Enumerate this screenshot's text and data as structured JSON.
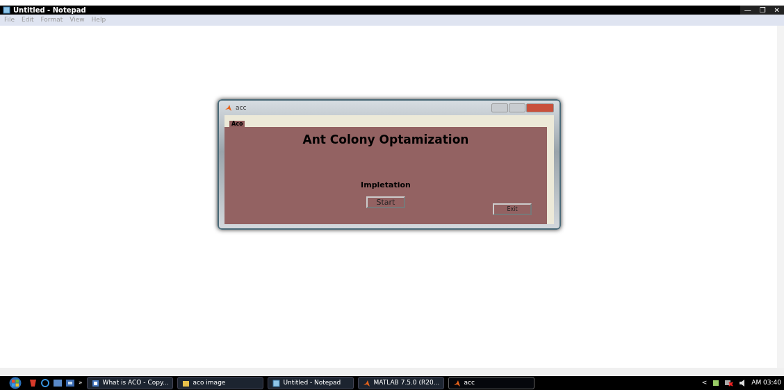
{
  "window": {
    "title": "Untitled - Notepad",
    "controls": [
      "—",
      "❐",
      "✕"
    ]
  },
  "menu": [
    "File",
    "Edit",
    "Format",
    "View",
    "Help"
  ],
  "dialog": {
    "title": "acc",
    "panel_tab": "Aco",
    "heading": "Ant Colony Optamization",
    "label": "Impletation",
    "buttons": [
      {
        "kind": "start",
        "label": "Start"
      },
      {
        "kind": "exit",
        "label": "Exit"
      }
    ]
  },
  "taskbar": {
    "more": "»",
    "tasks": [
      {
        "label": "What is ACO - Copy...",
        "kind": "doc",
        "selected": false
      },
      {
        "label": "aco image",
        "kind": "folder",
        "selected": false
      },
      {
        "label": "Untitled - Notepad",
        "kind": "notepad",
        "selected": false
      },
      {
        "label": "MATLAB 7.5.0 (R20...",
        "kind": "matlab",
        "selected": false
      },
      {
        "label": "acc",
        "kind": "matlab",
        "selected": true
      }
    ],
    "tray_toggle": "<",
    "clock": "AM 03:40"
  }
}
